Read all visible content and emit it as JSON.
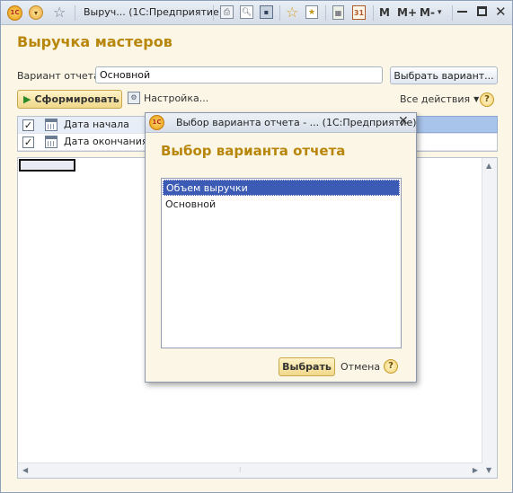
{
  "window": {
    "title": "Выруч...  (1С:Предприятие)",
    "toolbar": {
      "m": "M",
      "m_plus": "M+",
      "m_minus": "M-"
    }
  },
  "form": {
    "title": "Выручка мастеров",
    "variant_label": "Вариант отчета:",
    "variant_value": "Основной",
    "choose_variant_button": "Выбрать вариант...",
    "generate_button": "Сформировать",
    "settings_button": "Настройка...",
    "all_actions": "Все действия",
    "help": "?"
  },
  "params": [
    {
      "label": "Дата начала",
      "checked": true
    },
    {
      "label": "Дата окончания",
      "checked": true
    }
  ],
  "modal": {
    "title": "Выбор варианта отчета - ...  (1С:Предприятие)",
    "heading": "Выбор варианта отчета",
    "items": [
      "Объем выручки",
      "Основной"
    ],
    "selected_index": 0,
    "select_button": "Выбрать",
    "cancel_button": "Отмена",
    "help": "?"
  },
  "colors": {
    "accent_title": "#b8860b",
    "selection": "#3b5bb5",
    "background": "#fbf6e6"
  }
}
